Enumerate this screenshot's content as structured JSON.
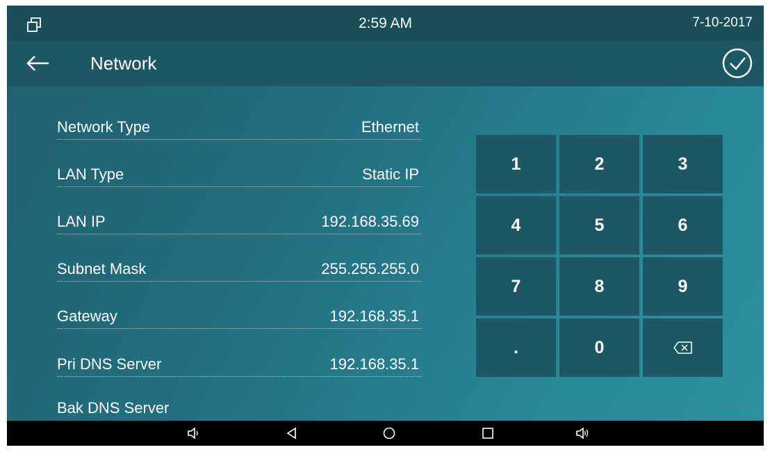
{
  "status": {
    "time": "2:59 AM",
    "date": "7-10-2017"
  },
  "header": {
    "title": "Network"
  },
  "fields": [
    {
      "label": "Network Type",
      "value": "Ethernet"
    },
    {
      "label": "LAN Type",
      "value": "Static IP"
    },
    {
      "label": "LAN IP",
      "value": "192.168.35.69"
    },
    {
      "label": "Subnet Mask",
      "value": "255.255.255.0"
    },
    {
      "label": "Gateway",
      "value": "192.168.35.1"
    },
    {
      "label": "Pri DNS Server",
      "value": "192.168.35.1"
    },
    {
      "label": "Bak DNS Server",
      "value": ""
    }
  ],
  "keypad": {
    "keys": [
      "1",
      "2",
      "3",
      "4",
      "5",
      "6",
      "7",
      "8",
      "9",
      ".",
      "0"
    ],
    "delete_icon": "backspace-icon"
  },
  "navbar": {
    "icons": [
      "volume-down-icon",
      "back-triangle-icon",
      "home-circle-icon",
      "recents-square-icon",
      "volume-up-icon"
    ]
  },
  "colors": {
    "statusbar": "#1b4d5b",
    "titlebar": "#1f5666",
    "key_bg": "#1d5664",
    "background_accent": "#2a8797"
  }
}
